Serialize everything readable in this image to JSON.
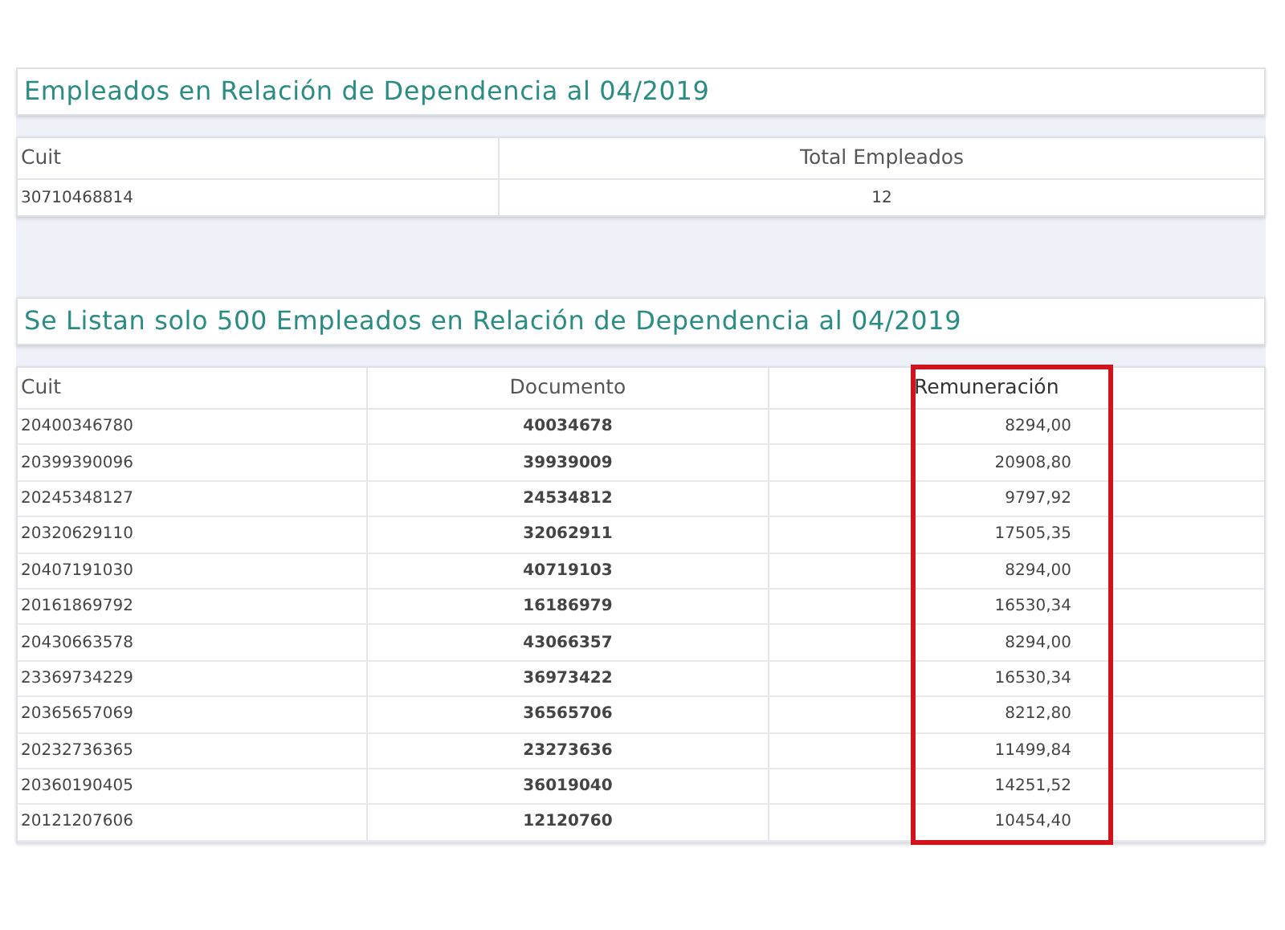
{
  "summary": {
    "title": "Empleados en Relación de Dependencia al 04/2019",
    "columns": [
      "Cuit",
      "Total Empleados"
    ],
    "rows": [
      [
        "30710468814",
        "12"
      ]
    ]
  },
  "employees": {
    "title": "Se Listan solo 500 Empleados en Relación de Dependencia al 04/2019",
    "columns": [
      {
        "label": "Cuit",
        "highlighted": false
      },
      {
        "label": "Documento",
        "highlighted": false
      },
      {
        "label": "Remuneración",
        "highlighted": true
      }
    ],
    "rows": [
      [
        "20400346780",
        "40034678",
        "8294,00"
      ],
      [
        "20399390096",
        "39939009",
        "20908,80"
      ],
      [
        "20245348127",
        "24534812",
        "9797,92"
      ],
      [
        "20320629110",
        "32062911",
        "17505,35"
      ],
      [
        "20407191030",
        "40719103",
        "8294,00"
      ],
      [
        "20161869792",
        "16186979",
        "16530,34"
      ],
      [
        "20430663578",
        "43066357",
        "8294,00"
      ],
      [
        "23369734229",
        "36973422",
        "16530,34"
      ],
      [
        "20365657069",
        "36565706",
        "8212,80"
      ],
      [
        "20232736365",
        "23273636",
        "11499,84"
      ],
      [
        "20360190405",
        "36019040",
        "14251,52"
      ],
      [
        "20121207606",
        "12120760",
        "10454,40"
      ]
    ]
  }
}
